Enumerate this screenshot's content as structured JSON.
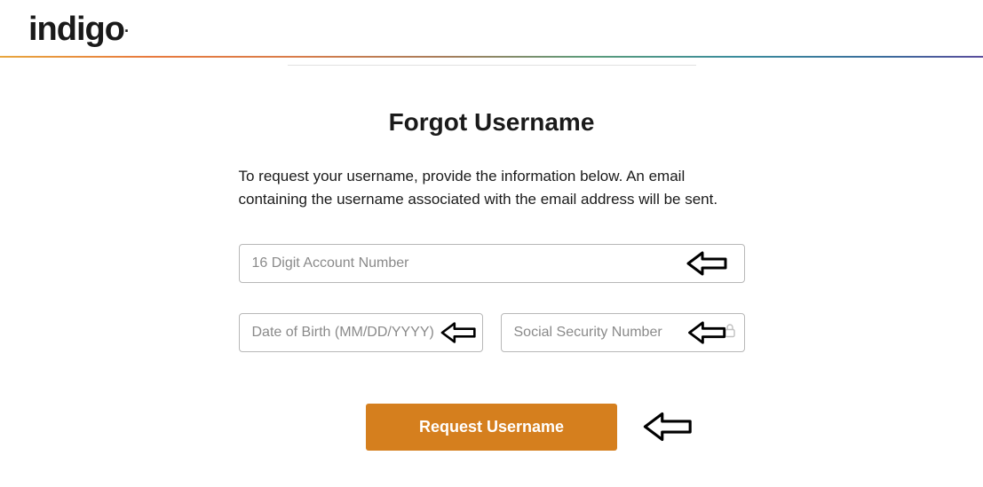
{
  "brand": {
    "name": "indigo"
  },
  "page": {
    "title": "Forgot Username",
    "instruction": "To request your username, provide the information below. An email containing the username associated with the email address will be sent."
  },
  "fields": {
    "account": {
      "placeholder": "16 Digit Account Number",
      "value": ""
    },
    "dob": {
      "placeholder": "Date of Birth (MM/DD/YYYY)",
      "value": ""
    },
    "ssn": {
      "placeholder": "Social Security Number",
      "value": ""
    }
  },
  "actions": {
    "submit_label": "Request Username"
  }
}
